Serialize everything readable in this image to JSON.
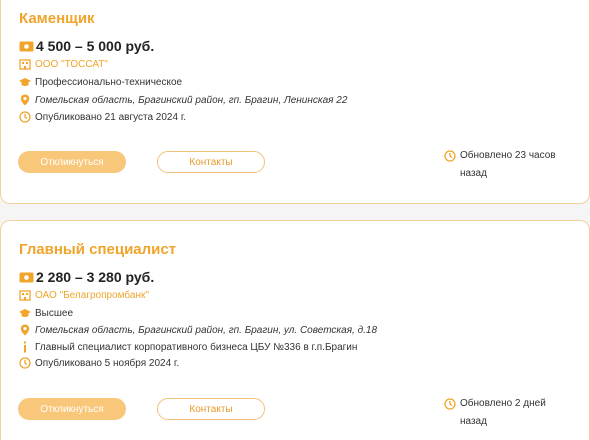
{
  "colors": {
    "accent": "#f0a52a",
    "button_fill": "#f8c77a",
    "border": "#f3d29a"
  },
  "vacancies": [
    {
      "title": "Каменщик",
      "salary": "4 500 – 5 000 руб.",
      "company": "ООО \"ТОССАТ\"",
      "education": "Профессионально-техническое",
      "address": "Гомельская область, Брагинский район, гп. Брагин, Ленинская 22",
      "published": "Опубликовано 21 августа 2024 г.",
      "apply_label": "Откликнуться",
      "contacts_label": "Контакты",
      "updated_line1": "Обновлено 23 часов",
      "updated_line2": "назад"
    },
    {
      "title": "Главный специалист",
      "salary": "2 280 – 3 280 руб.",
      "company": "ОАО \"Белагропромбанк\"",
      "education": "Высшее",
      "address": "Гомельская область, Брагинский район, гп. Брагин, ул. Советская, д.18",
      "info": "Главный специалист корпоративного бизнеса ЦБУ №336 в г.п.Брагин",
      "published": "Опубликовано 5 ноября 2024 г.",
      "apply_label": "Откликнуться",
      "contacts_label": "Контакты",
      "updated_line1": "Обновлено 2 дней",
      "updated_line2": "назад"
    }
  ]
}
